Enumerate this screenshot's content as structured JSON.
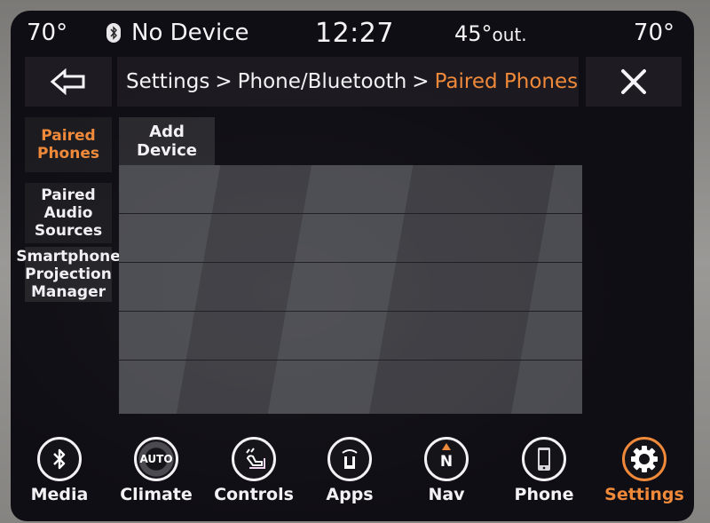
{
  "status_bar": {
    "driver_temp": "70°",
    "bluetooth_icon": "bluetooth-icon",
    "bluetooth_status": "No Device",
    "time": "12:27",
    "outside_temp": "45°",
    "outside_suffix": "out.",
    "passenger_temp": "70°"
  },
  "header": {
    "back_icon": "arrow-left-icon",
    "breadcrumb": [
      {
        "label": "Settings"
      },
      {
        "label": "Phone/Bluetooth"
      },
      {
        "label": "Paired Phones"
      }
    ],
    "separator": ">",
    "close_icon": "close-icon"
  },
  "sidebar": {
    "items": [
      {
        "line1": "Paired",
        "line2": "Phones",
        "line3": "",
        "active": true
      },
      {
        "line1": "Paired",
        "line2": "Audio",
        "line3": "Sources",
        "active": false
      },
      {
        "line1": "Smartphone",
        "line2": "Projection",
        "line3": "Manager",
        "active": false
      }
    ]
  },
  "main": {
    "add_device": {
      "line1": "Add",
      "line2": "Device"
    },
    "device_rows": [
      "",
      "",
      "",
      "",
      ""
    ]
  },
  "bottom_nav": {
    "active_color": "#f08a3a",
    "items": [
      {
        "label": "Media",
        "icon": "bluetooth-icon"
      },
      {
        "label": "Climate",
        "icon": "climate-auto-icon",
        "icon_text": "AUTO"
      },
      {
        "label": "Controls",
        "icon": "seat-controls-icon"
      },
      {
        "label": "Apps",
        "icon": "uconnect-apps-icon"
      },
      {
        "label": "Nav",
        "icon": "compass-north-icon",
        "icon_text": "N"
      },
      {
        "label": "Phone",
        "icon": "smartphone-icon"
      },
      {
        "label": "Settings",
        "icon": "gear-icon",
        "active": true
      }
    ]
  }
}
